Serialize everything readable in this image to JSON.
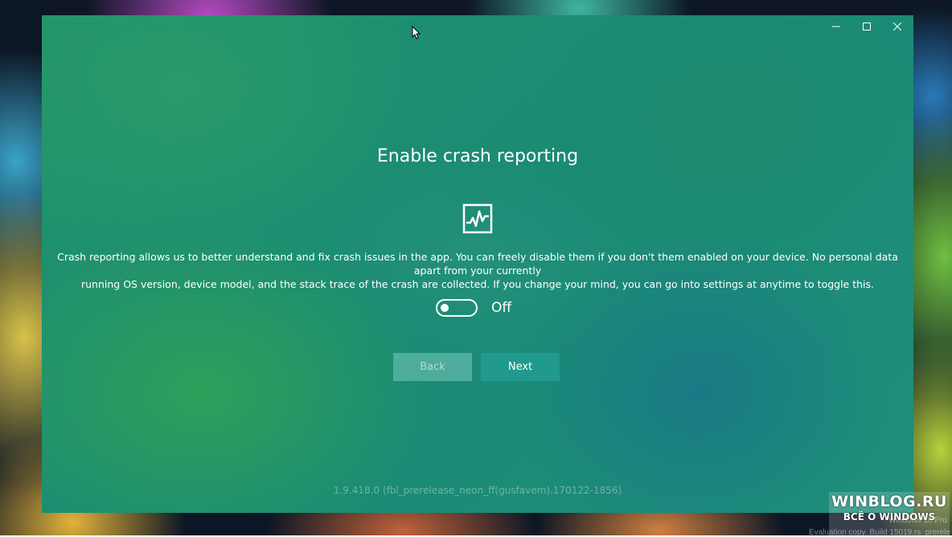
{
  "window": {
    "controls": {
      "minimize_icon": "minimize-icon",
      "maximize_icon": "maximize-icon",
      "close_icon": "close-icon"
    }
  },
  "page": {
    "title": "Enable crash reporting",
    "icon": "activity-chart-icon",
    "description_line1": "Crash reporting allows us to better understand and fix crash issues in the app. You can freely disable them if you don't them enabled on your device. No personal data apart from your currently",
    "description_line2": "running OS version, device model, and the stack trace of the crash are collected. If you change your mind, you can go into settings at anytime to toggle this.",
    "toggle": {
      "state": "off",
      "label": "Off"
    },
    "back_label": "Back",
    "next_label": "Next",
    "version": "1.9.418.0 (fbl_prerelease_neon_ff(gusfavem).170122-1856)"
  },
  "desktop": {
    "brand_title": "WINBLOG.RU",
    "brand_subtitle": "ВСЁ О WINDOWS",
    "os_edition": "Windows 10 Pro",
    "build_info": "Evaluation copy. Build 15019.rs_prerele"
  },
  "colors": {
    "window_accent": "#1f9a8c",
    "text": "#ffffff"
  }
}
